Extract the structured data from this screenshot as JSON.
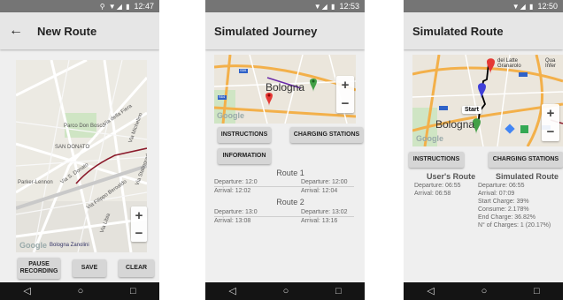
{
  "screens": [
    {
      "status_time": "12:47",
      "title": "New Route",
      "back_icon": "arrow-back-icon",
      "map_labels": [
        "Parco Don Bosco",
        "SAN DONATO",
        "Parker-Lennon",
        "Via della Fiera",
        "Via Michelino",
        "Via S. Donato",
        "Via Stalingrado",
        "Via Filippo Beroaldo",
        "Via Libia",
        "Bologna Zanolini"
      ],
      "google_text": "Google",
      "buttons": {
        "pause": "PAUSE RECORDING",
        "save": "SAVE",
        "clear": "CLEAR"
      }
    },
    {
      "status_time": "12:53",
      "title": "Simulated Journey",
      "city_label": "Bologna",
      "google_text": "Google",
      "road_labels": [
        "S59",
        "S64"
      ],
      "buttons": {
        "instructions": "INSTRUCTIONS",
        "charging": "CHARGING STATIONS",
        "information": "INFORMATION"
      },
      "routes": [
        {
          "name": "Route 1",
          "dep_left": "Departure: 12:0",
          "arr_left": "Arrival: 12:02",
          "dep_right": "Departure: 12:00",
          "arr_right": "Arrival: 12:04"
        },
        {
          "name": "Route 2",
          "dep_left": "Departure: 13:0",
          "arr_left": "Arrival: 13:08",
          "dep_right": "Departure: 13:02",
          "arr_right": "Arrival: 13:16"
        }
      ]
    },
    {
      "status_time": "12:50",
      "title": "Simulated Route",
      "city_label": "Bologna",
      "google_text": "Google",
      "place_label": "del Latte Granarolo",
      "place_label_right": "Qua Infer",
      "start_label": "Start",
      "buttons": {
        "instructions": "INSTRUCTIONS",
        "charging": "CHARGING STATIONS"
      },
      "user_route": {
        "heading": "User's Route",
        "departure": "Departure: 06:55",
        "arrival": "Arrival: 06:58"
      },
      "simulated_route": {
        "heading": "Simulated Route",
        "departure": "Departure: 06:55",
        "arrival": "Arrival: 07:09",
        "start_charge": "Start Charge: 39%",
        "consume": "Consume: 2.178%",
        "end_charge": "End Charge: 36.82%",
        "n_charges": "N° of Charges: 1 (20.17%)"
      }
    }
  ],
  "nav": {
    "back": "◁",
    "home": "○",
    "recents": "□"
  },
  "zoom": {
    "in": "+",
    "out": "−"
  },
  "colors": {
    "route_line": "#8b1a2b",
    "pin_red": "#e53935",
    "pin_green": "#43a047",
    "pin_purple": "#3f3fd8",
    "road_orange": "#f3b04a"
  }
}
